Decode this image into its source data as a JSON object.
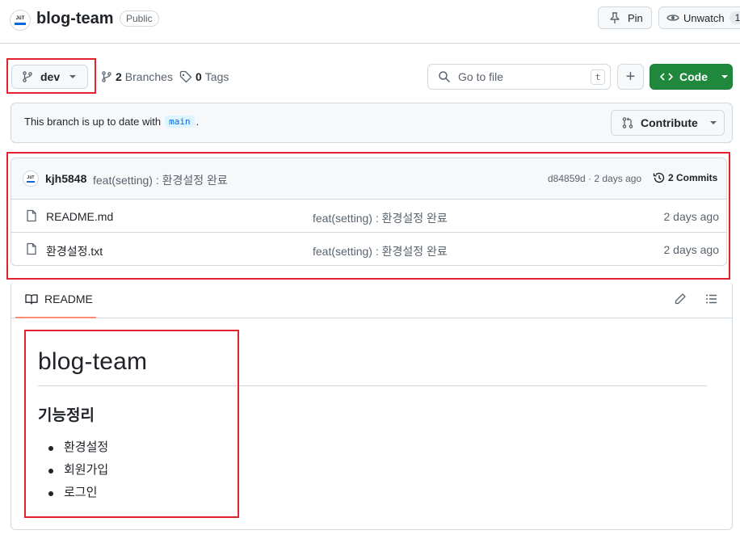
{
  "repo": {
    "name": "blog-team",
    "visibility": "Public",
    "avatar_text": "JüT"
  },
  "header_actions": {
    "pin_label": "Pin",
    "unwatch_label": "Unwatch",
    "watch_count": "1"
  },
  "toolbar": {
    "branch": "dev",
    "branches_count": "2",
    "branches_label": "Branches",
    "tags_count": "0",
    "tags_label": "Tags",
    "search_placeholder": "Go to file",
    "search_shortcut": "t",
    "add_label": "+",
    "code_label": "Code"
  },
  "branch_status": {
    "text": "This branch is up to date with",
    "base_branch": "main",
    "suffix": ".",
    "contribute_label": "Contribute"
  },
  "latest_commit": {
    "author": "kjh5848",
    "message": "feat(setting) : 환경설정 완료",
    "sha_time": "d84859d · 2 days ago",
    "commits_label": "2 Commits"
  },
  "files": [
    {
      "name": "README.md",
      "message": "feat(setting) : 환경설정 완료",
      "time": "2 days ago"
    },
    {
      "name": "환경설정.txt",
      "message": "feat(setting) : 환경설정 완료",
      "time": "2 days ago"
    }
  ],
  "readme": {
    "tab_label": "README",
    "title": "blog-team",
    "section_heading": "기능정리",
    "items": [
      "환경설정",
      "회원가입",
      "로그인"
    ]
  },
  "colors": {
    "accent_green": "#1f883d",
    "highlight_red": "#e0232f",
    "tab_underline": "#fd8c73"
  }
}
